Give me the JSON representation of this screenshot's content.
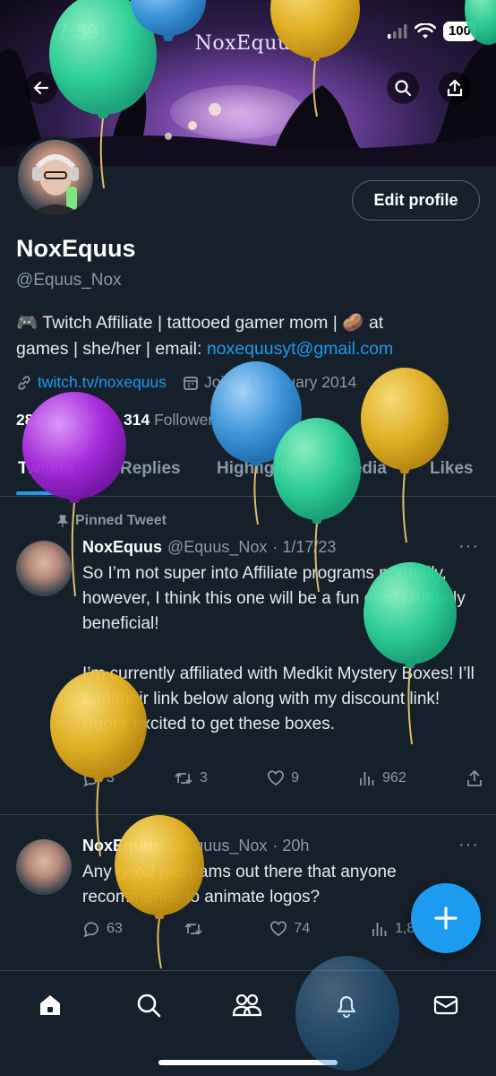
{
  "status_bar": {
    "time": "7:59",
    "battery": "100"
  },
  "banner": {
    "title": "NoxEquus"
  },
  "profile": {
    "edit_label": "Edit profile",
    "display_name": "NoxEquus",
    "handle": "@Equus_Nox",
    "bio_line1": "🎮 Twitch Affiliate | tattooed gamer mom | 🥔 at",
    "bio_line2_prefix": "games | she/her | email: ",
    "bio_email": "noxequusyt@gmail.com",
    "website": "twitch.tv/noxequus",
    "joined": "Joined February 2014",
    "following_count": "282",
    "following_label": "Following",
    "followers_count": "314",
    "followers_label": "Followers"
  },
  "tabs": [
    "Tweets",
    "Replies",
    "Highlights",
    "Media",
    "Likes"
  ],
  "pinned_label": "Pinned Tweet",
  "tweets": [
    {
      "name": "NoxEquus",
      "handle": "@Equus_Nox",
      "time": "· 1/17/23",
      "text": "So I’m not super into Affiliate programs normally, however, I think this one will be a fun one. Mutually beneficial!\n\nI’m currently affiliated with Medkit Mystery Boxes! I’ll add their link below along with my discount link! Super excited to get these boxes.",
      "replies": "3",
      "retweets": "3",
      "likes": "9",
      "views": "962"
    },
    {
      "name": "NoxEquus",
      "handle": "@Equus_Nox",
      "time": "· 20h",
      "text": "Any good programs out there that anyone recommends to animate logos?",
      "replies": "63",
      "retweets": "",
      "likes": "74",
      "views": "1,87"
    }
  ],
  "icons": {
    "back": "back-arrow-icon",
    "search": "search-icon",
    "share": "share-icon",
    "link": "link-icon",
    "calendar": "calendar-icon",
    "pin": "pin-icon",
    "compose": "plus-icon",
    "home": "home-icon",
    "explore": "search-icon",
    "communities": "communities-icon",
    "notifications": "bell-icon",
    "messages": "mail-icon"
  },
  "colors": {
    "accent": "#1d9bf0",
    "background": "#15202b",
    "muted": "#8b98a5",
    "divider": "#38444d"
  }
}
